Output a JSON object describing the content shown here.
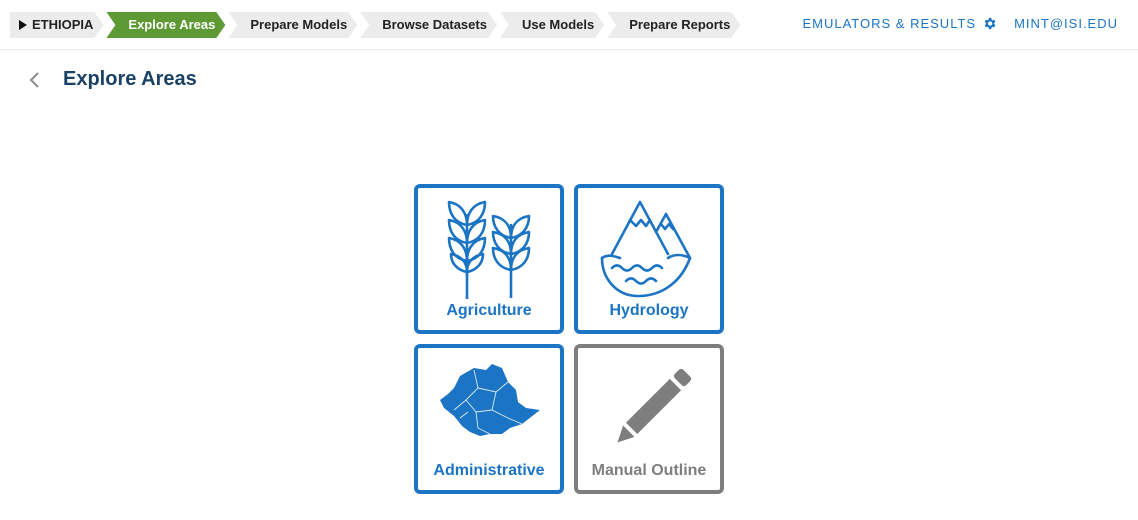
{
  "breadcrumbs": {
    "region": "ETHIOPIA",
    "items": [
      "Explore Areas",
      "Prepare Models",
      "Browse Datasets",
      "Use Models",
      "Prepare Reports"
    ]
  },
  "toplinks": {
    "emulators": "EMULATORS & RESULTS",
    "user": "MINT@ISI.EDU"
  },
  "page": {
    "title": "Explore Areas"
  },
  "tiles": {
    "agriculture": "Agriculture",
    "hydrology": "Hydrology",
    "administrative": "Administrative",
    "manual": "Manual Outline"
  },
  "colors": {
    "accent": "#1b74c4",
    "active_crumb": "#5e9a34",
    "title": "#1a4166",
    "disabled": "#7e7e7e"
  },
  "icons": {
    "back": "chevron-left-icon",
    "settings": "gear-icon",
    "agriculture": "wheat-icon",
    "hydrology": "water-mountain-icon",
    "administrative": "ethiopia-map-icon",
    "manual": "pencil-icon"
  }
}
